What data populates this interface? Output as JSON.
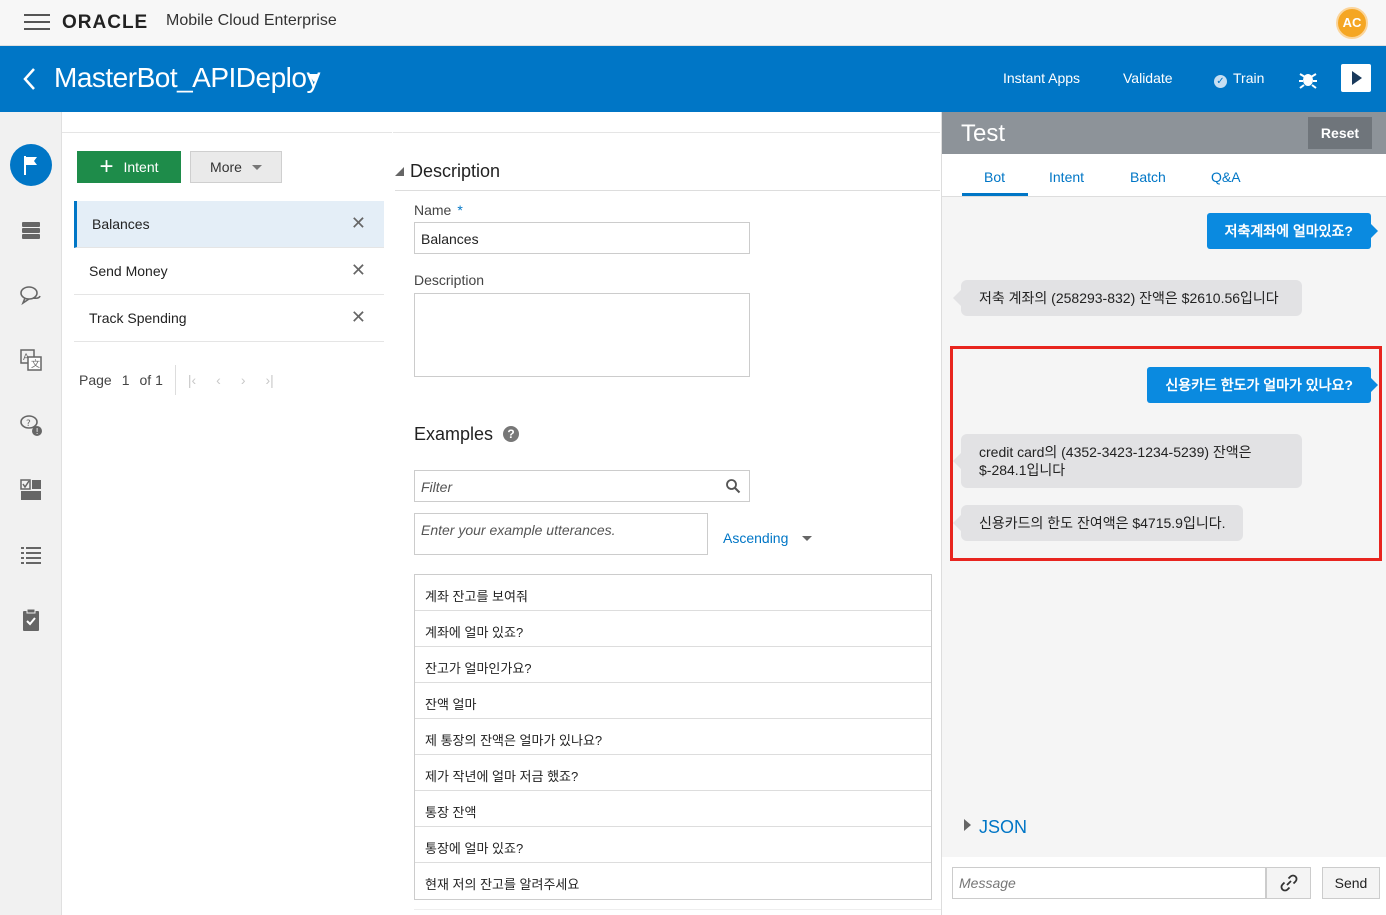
{
  "header": {
    "brand": "ORACLE",
    "product": "Mobile Cloud Enterprise",
    "user_initials": "AC"
  },
  "botbar": {
    "title": "MasterBot_APIDeploy",
    "links": [
      "Instant Apps",
      "Validate",
      "Train"
    ]
  },
  "rail": {
    "items": [
      "flag-icon",
      "database-icon",
      "chat-icon",
      "translate-icon",
      "qna-icon",
      "components-icon",
      "list-icon",
      "clipboard-icon"
    ]
  },
  "intents": {
    "add_label": "Intent",
    "more_label": "More",
    "items": [
      {
        "name": "Balances"
      },
      {
        "name": "Send Money"
      },
      {
        "name": "Track Spending"
      }
    ],
    "pager": {
      "page_label": "Page",
      "current": "1",
      "of_label": "of 1"
    }
  },
  "form": {
    "section_title": "Description",
    "name_label": "Name",
    "name_required": "*",
    "name_value": "Balances",
    "description_label": "Description",
    "description_value": "",
    "examples_title": "Examples",
    "help": "?",
    "filter_placeholder": "Filter",
    "utterance_placeholder": "Enter your example utterances.",
    "sort_label": "Ascending",
    "examples": [
      "계좌 잔고를 보여줘",
      "계좌에 얼마 있죠?",
      "잔고가 얼마인가요?",
      "잔액 얼마",
      "제 통장의 잔액은 얼마가 있나요?",
      "제가 작년에 얼마 저금 했죠?",
      "통장 잔액",
      "통장에 얼마 있죠?",
      "현재 저의 잔고를 알려주세요"
    ]
  },
  "test": {
    "title": "Test",
    "reset_label": "Reset",
    "tabs": [
      "Bot",
      "Intent",
      "Batch",
      "Q&A"
    ],
    "messages": [
      {
        "from": "user",
        "text": "저축계좌에 얼마있죠?"
      },
      {
        "from": "bot",
        "text": "저축 계좌의 (258293-832) 잔액은 $2610.56입니다"
      },
      {
        "from": "user",
        "text": "신용카드 한도가 얼마가 있나요?"
      },
      {
        "from": "bot",
        "text": "credit card의 (4352-3423-1234-5239) 잔액은 $-284.1입니다"
      },
      {
        "from": "bot",
        "text": "신용카드의 한도 잔여액은 $4715.9입니다."
      }
    ],
    "json_label": "JSON",
    "message_placeholder": "Message",
    "send_label": "Send"
  },
  "colors": {
    "brand_blue": "#0076c6",
    "add_green": "#1e8c4a",
    "highlight_red": "#e8251f",
    "test_header": "#8d9399"
  }
}
